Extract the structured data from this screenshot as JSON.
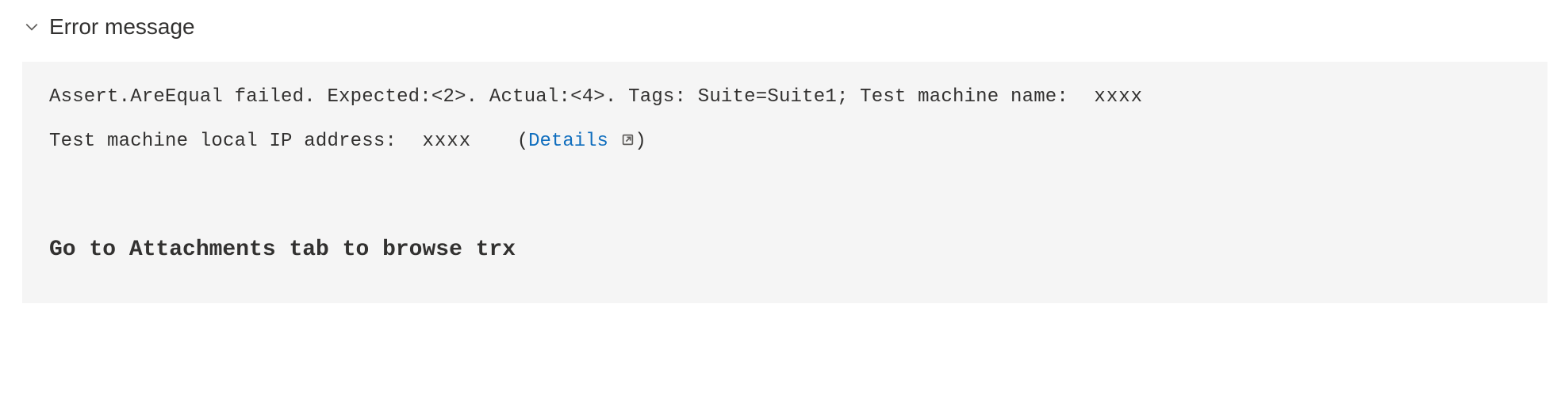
{
  "header": {
    "title": "Error message"
  },
  "error": {
    "line1_prefix": "Assert.AreEqual failed. Expected:<2>. Actual:<4>. Tags: Suite=Suite1; Test machine name:",
    "machine_name": "xxxx",
    "line2_prefix": "Test machine local IP address:",
    "ip_redacted": "xxxx",
    "paren_open": "(",
    "details_label": "Details",
    "paren_close": ")",
    "bold_message": "Go to Attachments tab to browse trx"
  }
}
